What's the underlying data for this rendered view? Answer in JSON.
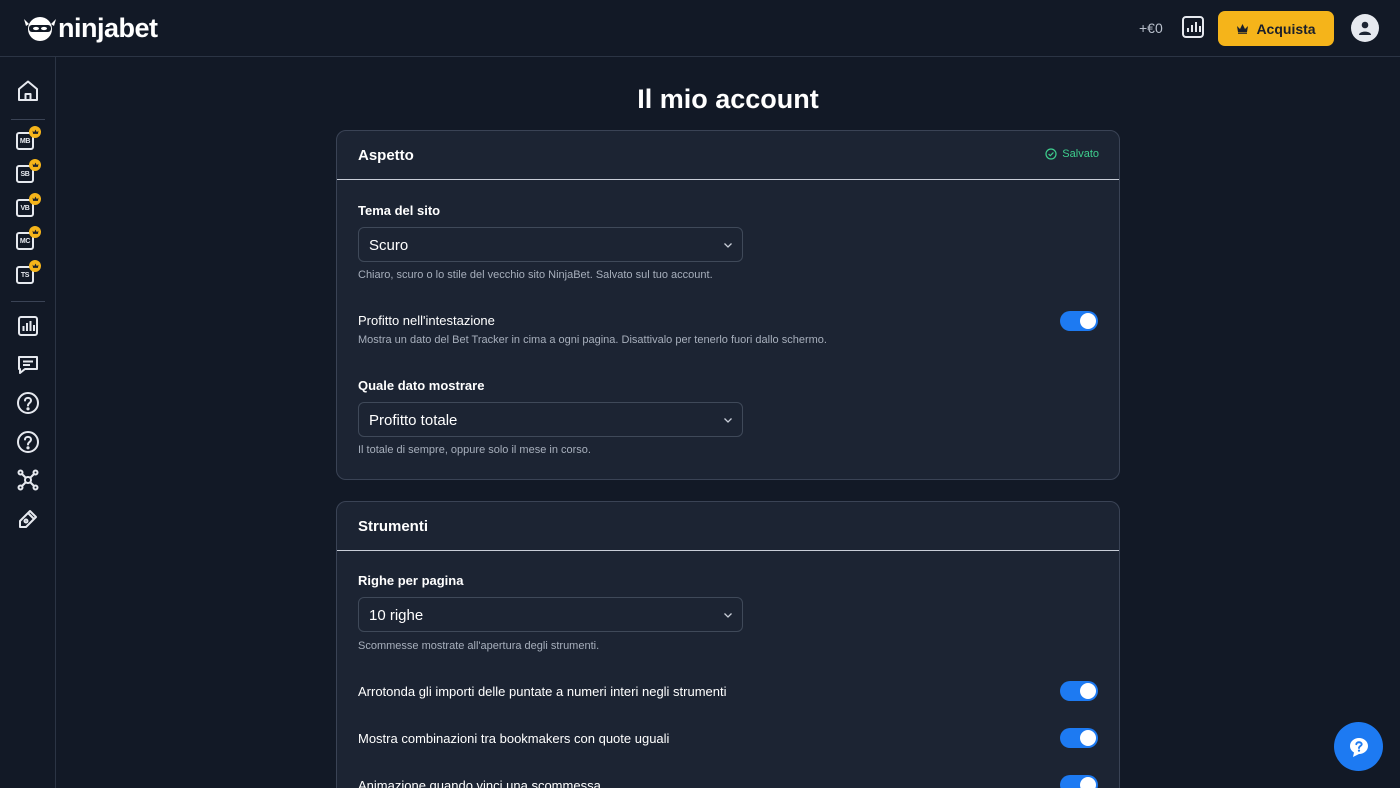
{
  "header": {
    "logo_text": "ninjabet",
    "profit": "+€0",
    "buy_label": "Acquista"
  },
  "sidebar": {
    "tools": [
      {
        "abbr": "MB"
      },
      {
        "abbr": "SB"
      },
      {
        "abbr": "VB"
      },
      {
        "abbr": "MC"
      },
      {
        "abbr": "TS"
      }
    ]
  },
  "page": {
    "title": "Il mio account"
  },
  "appearance": {
    "title": "Aspetto",
    "saved_label": "Salvato",
    "theme_label": "Tema del sito",
    "theme_value": "Scuro",
    "theme_help": "Chiaro, scuro o lo stile del vecchio sito NinjaBet. Salvato sul tuo account.",
    "profit_header_label": "Profitto nell'intestazione",
    "profit_header_help": "Mostra un dato del Bet Tracker in cima a ogni pagina. Disattivalo per tenerlo fuori dallo schermo.",
    "profit_header_on": true,
    "which_label": "Quale dato mostrare",
    "which_value": "Profitto totale",
    "which_help": "Il totale di sempre, oppure solo il mese in corso."
  },
  "tools": {
    "title": "Strumenti",
    "rows_label": "Righe per pagina",
    "rows_value": "10 righe",
    "rows_help": "Scommesse mostrate all'apertura degli strumenti.",
    "round_label": "Arrotonda gli importi delle puntate a numeri interi negli strumenti",
    "round_on": true,
    "combos_label": "Mostra combinazioni tra bookmakers con quote uguali",
    "combos_on": true,
    "anim_label": "Animazione quando vinci una scommessa",
    "anim_on": true
  },
  "colors": {
    "background": "#121926",
    "card": "#1c2433",
    "accent": "#1d7af2",
    "buy": "#f5b41a",
    "saved": "#3ecf8e"
  }
}
